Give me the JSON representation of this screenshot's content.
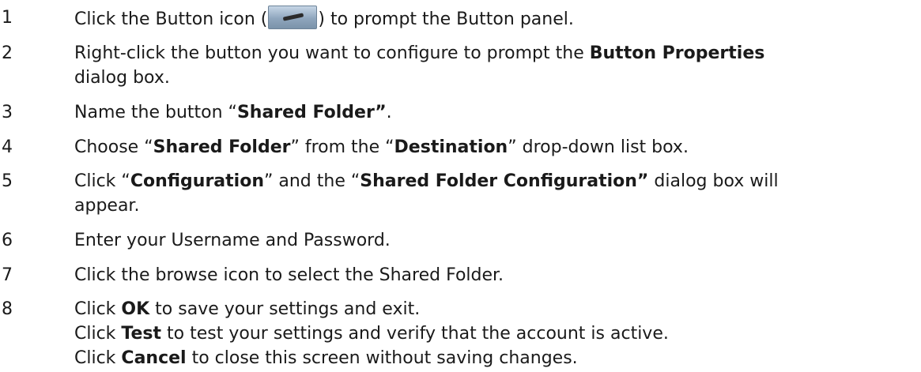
{
  "steps": [
    {
      "number": "1",
      "lines": [
        [
          {
            "t": "Click the Button icon ("
          },
          {
            "icon": "button-panel-icon"
          },
          {
            "t": ") to prompt the Button panel."
          }
        ]
      ]
    },
    {
      "number": "2",
      "lines": [
        [
          {
            "t": "Right-click the button you want to configure to prompt the "
          },
          {
            "t": "Button Properties",
            "b": true
          }
        ],
        [
          {
            "t": "dialog box."
          }
        ]
      ]
    },
    {
      "number": "3",
      "lines": [
        [
          {
            "t": "Name the button “"
          },
          {
            "t": "Shared Folder”",
            "b": true
          },
          {
            "t": "."
          }
        ]
      ]
    },
    {
      "number": "4",
      "lines": [
        [
          {
            "t": "Choose “"
          },
          {
            "t": "Shared Folder",
            "b": true
          },
          {
            "t": "” from the “"
          },
          {
            "t": "Destination",
            "b": true
          },
          {
            "t": "” drop-down list box."
          }
        ]
      ]
    },
    {
      "number": "5",
      "lines": [
        [
          {
            "t": "Click “"
          },
          {
            "t": "Configuration",
            "b": true
          },
          {
            "t": "” and the “"
          },
          {
            "t": "Shared Folder Configuration”",
            "b": true
          },
          {
            "t": " dialog box will"
          }
        ],
        [
          {
            "t": "appear."
          }
        ]
      ]
    },
    {
      "number": "6",
      "lines": [
        [
          {
            "t": "Enter your Username and Password."
          }
        ]
      ]
    },
    {
      "number": "7",
      "lines": [
        [
          {
            "t": "Click the browse icon to select the Shared Folder."
          }
        ]
      ]
    },
    {
      "number": "8",
      "lines": [
        [
          {
            "t": "Click "
          },
          {
            "t": "OK",
            "b": true
          },
          {
            "t": " to save your settings and exit."
          }
        ],
        [
          {
            "t": "Click "
          },
          {
            "t": "Test",
            "b": true
          },
          {
            "t": " to test your settings and verify that the account is active."
          }
        ],
        [
          {
            "t": "Click "
          },
          {
            "t": "Cancel",
            "b": true
          },
          {
            "t": " to close this screen without saving changes."
          }
        ]
      ]
    }
  ]
}
